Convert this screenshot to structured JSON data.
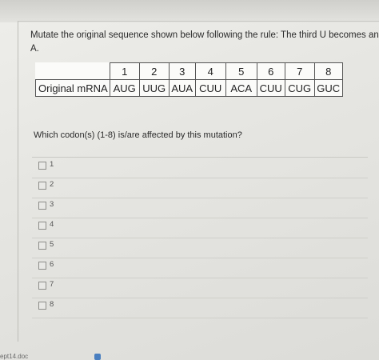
{
  "question": {
    "prompt_line1": "Mutate the original sequence shown below following the rule:  The third U becomes an",
    "prompt_line2": "A.",
    "sub_question": "Which codon(s) (1-8) is/are affected by this mutation?"
  },
  "table": {
    "headers": [
      "1",
      "2",
      "3",
      "4",
      "5",
      "6",
      "7",
      "8"
    ],
    "row_label": "Original mRNA",
    "codons": [
      "AUG",
      "UUG",
      "AUA",
      "CUU",
      "ACA",
      "CUU",
      "CUG",
      "GUC"
    ]
  },
  "options": [
    {
      "label": "1"
    },
    {
      "label": "2"
    },
    {
      "label": "3"
    },
    {
      "label": "4"
    },
    {
      "label": "5"
    },
    {
      "label": "6"
    },
    {
      "label": "7"
    },
    {
      "label": "8"
    }
  ],
  "footer": {
    "filename": "ept14.doc"
  }
}
